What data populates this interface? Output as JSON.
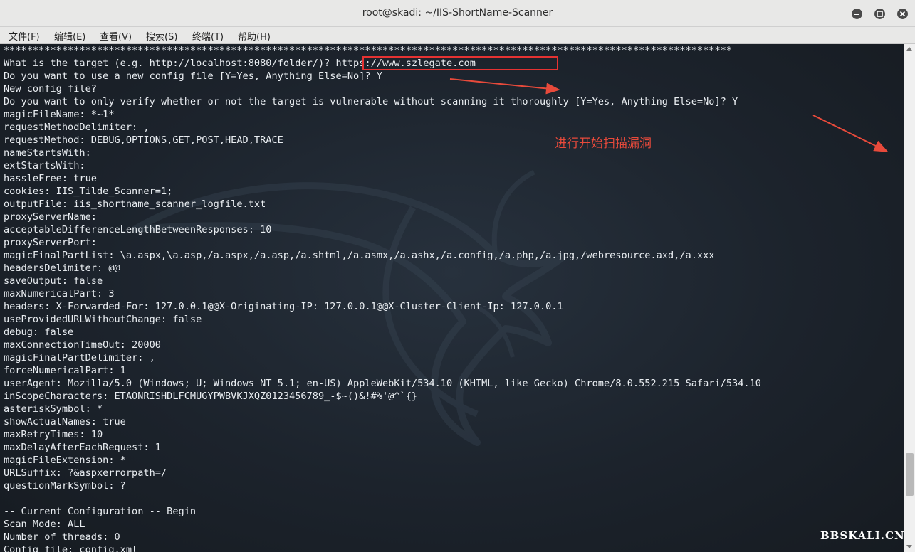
{
  "window": {
    "title": "root@skadi: ~/IIS-ShortName-Scanner"
  },
  "menu": {
    "items": [
      {
        "label": "文件(F)"
      },
      {
        "label": "编辑(E)"
      },
      {
        "label": "查看(V)"
      },
      {
        "label": "搜索(S)"
      },
      {
        "label": "终端(T)"
      },
      {
        "label": "帮助(H)"
      }
    ]
  },
  "terminal": {
    "lines": [
      "*****************************************************************************************************************************",
      "What is the target (e.g. http://localhost:8080/folder/)? https://www.szlegate.com",
      "Do you want to use a new config file [Y=Yes, Anything Else=No]? Y",
      "New config file?",
      "Do you want to only verify whether or not the target is vulnerable without scanning it thoroughly [Y=Yes, Anything Else=No]? Y",
      "magicFileName: *~1*",
      "requestMethodDelimiter: ,",
      "requestMethod: DEBUG,OPTIONS,GET,POST,HEAD,TRACE",
      "nameStartsWith:",
      "extStartsWith:",
      "hassleFree: true",
      "cookies: IIS_Tilde_Scanner=1;",
      "outputFile: iis_shortname_scanner_logfile.txt",
      "proxyServerName:",
      "acceptableDifferenceLengthBetweenResponses: 10",
      "proxyServerPort:",
      "magicFinalPartList: \\a.aspx,\\a.asp,/a.aspx,/a.asp,/a.shtml,/a.asmx,/a.ashx,/a.config,/a.php,/a.jpg,/webresource.axd,/a.xxx",
      "headersDelimiter: @@",
      "saveOutput: false",
      "maxNumericalPart: 3",
      "headers: X-Forwarded-For: 127.0.0.1@@X-Originating-IP: 127.0.0.1@@X-Cluster-Client-Ip: 127.0.0.1",
      "useProvidedURLWithoutChange: false",
      "debug: false",
      "maxConnectionTimeOut: 20000",
      "magicFinalPartDelimiter: ,",
      "forceNumericalPart: 1",
      "userAgent: Mozilla/5.0 (Windows; U; Windows NT 5.1; en-US) AppleWebKit/534.10 (KHTML, like Gecko) Chrome/8.0.552.215 Safari/534.10",
      "inScopeCharacters: ETAONRISHDLFCMUGYPWBVKJXQZ0123456789_-$~()&!#%'@^`{}",
      "asteriskSymbol: *",
      "showActualNames: true",
      "maxRetryTimes: 10",
      "maxDelayAfterEachRequest: 1",
      "magicFileExtension: *",
      "URLSuffix: ?&aspxerrorpath=/",
      "questionMarkSymbol: ?",
      "",
      "-- Current Configuration -- Begin",
      "Scan Mode: ALL",
      "Number of threads: 0",
      "Config file: config.xml"
    ]
  },
  "annotation": {
    "text": "进行开始扫描漏洞"
  },
  "watermark": {
    "text": "BBSKALI.CN"
  },
  "colors": {
    "terminal_bg": "#1c232c",
    "terminal_fg": "#e9edf1",
    "highlight": "#e53232",
    "annotation": "#e84a3b"
  }
}
